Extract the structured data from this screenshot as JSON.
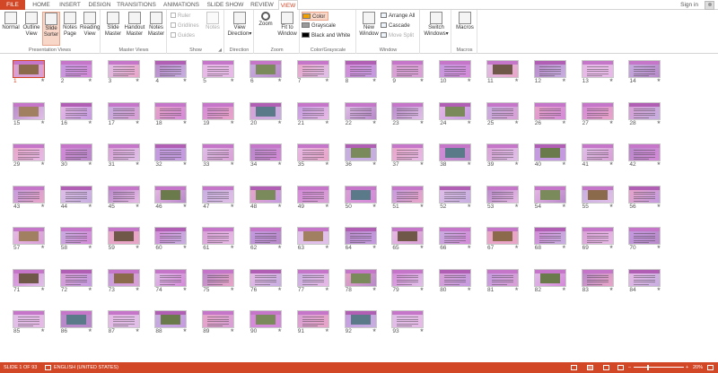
{
  "tabs": [
    {
      "label": "FILE",
      "kind": "file"
    },
    {
      "label": "HOME"
    },
    {
      "label": "INSERT"
    },
    {
      "label": "DESIGN"
    },
    {
      "label": "TRANSITIONS"
    },
    {
      "label": "ANIMATIONS"
    },
    {
      "label": "SLIDE SHOW"
    },
    {
      "label": "REVIEW"
    },
    {
      "label": "VIEW",
      "active": true
    }
  ],
  "account": {
    "signin": "Sign in",
    "icon": "user-avatar-icon"
  },
  "ribbon": {
    "presentation_views": {
      "label": "Presentation Views",
      "buttons": [
        {
          "l1": "Normal",
          "l2": "",
          "icon": "normal-view-icon"
        },
        {
          "l1": "Outline",
          "l2": "View",
          "icon": "outline-view-icon"
        },
        {
          "l1": "Slide",
          "l2": "Sorter",
          "icon": "slide-sorter-icon",
          "pressed": true
        },
        {
          "l1": "Notes",
          "l2": "Page",
          "icon": "notes-page-icon"
        },
        {
          "l1": "Reading",
          "l2": "View",
          "icon": "reading-view-icon"
        }
      ]
    },
    "master_views": {
      "label": "Master Views",
      "buttons": [
        {
          "l1": "Slide",
          "l2": "Master",
          "icon": "slide-master-icon"
        },
        {
          "l1": "Handout",
          "l2": "Master",
          "icon": "handout-master-icon"
        },
        {
          "l1": "Notes",
          "l2": "Master",
          "icon": "notes-master-icon"
        }
      ]
    },
    "show": {
      "label": "Show",
      "checks": [
        "Ruler",
        "Gridlines",
        "Guides"
      ],
      "notes": "Notes"
    },
    "direction": {
      "label": "Direction",
      "l1": "View",
      "l2": "Direction",
      "arrow": "▾"
    },
    "zoom": {
      "label": "Zoom",
      "zoom_btn": "Zoom",
      "fit_l1": "Fit to",
      "fit_l2": "Window"
    },
    "color": {
      "label": "Color/Grayscale",
      "items": [
        {
          "label": "Color",
          "swatch": "#f0a000"
        },
        {
          "label": "Grayscale",
          "swatch": "#9a9a9a"
        },
        {
          "label": "Black and White",
          "swatch": "#000000"
        }
      ]
    },
    "window": {
      "label": "Window",
      "new_l1": "New",
      "new_l2": "Window",
      "items": [
        "Arrange All",
        "Cascade",
        "Move Split"
      ]
    },
    "switch": {
      "label": "",
      "l1": "Switch",
      "l2": "Windows",
      "arrow": "▾"
    },
    "macros": {
      "label": "Macros",
      "btn": "Macros"
    }
  },
  "slides": {
    "count": 93,
    "selected": 1,
    "star": "★",
    "palette": [
      "#d48ad8",
      "#e7b9e6",
      "#c59be0",
      "#e8a5c8",
      "#b889c9",
      "#d9a0d6",
      "#c7aee0",
      "#e0bfe8"
    ],
    "photo_slides": [
      1,
      6,
      11,
      15,
      20,
      24,
      36,
      38,
      40,
      46,
      48,
      50,
      54,
      55,
      57,
      59,
      63,
      65,
      67,
      71,
      73,
      78,
      82,
      86,
      88,
      90,
      92
    ],
    "photo_colors": [
      "#7a8a5a",
      "#8a6a4a",
      "#5a7a8a",
      "#a08060",
      "#6a7a4a",
      "#705848"
    ]
  },
  "status": {
    "slide_of": "SLIDE 1 OF 93",
    "language": "ENGLISH (UNITED STATES)",
    "zoom": "20%",
    "minus": "–",
    "plus": "+"
  }
}
